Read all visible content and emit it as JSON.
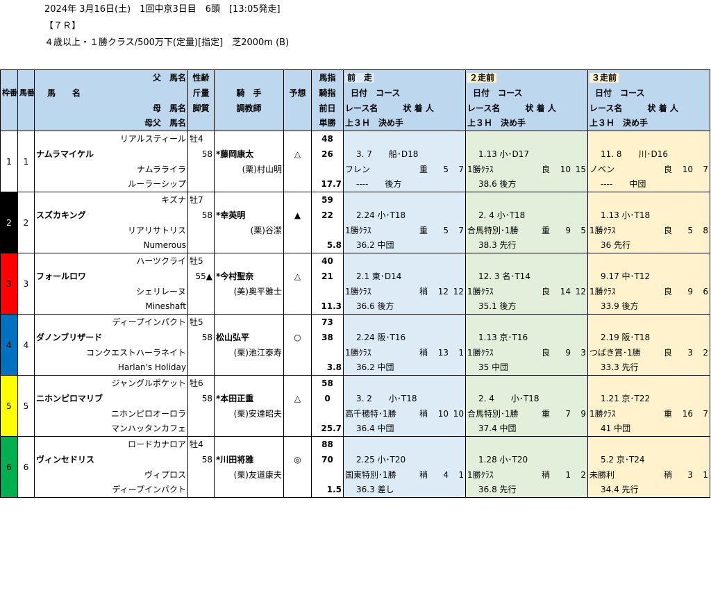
{
  "header": {
    "line1": "2024年 3月16日(土)　1回中京3日目　6頭　[13:05発走]",
    "line2": "【７Ｒ】",
    "line3": "４歳以上・１勝クラス/500万下(定量)[指定]　芝2000m (B)"
  },
  "columns": {
    "waku": "枠番",
    "umaban": "馬番",
    "father": "父　馬名",
    "horse_name": "馬　　名",
    "mother": "母　馬名",
    "mothers_father": "母父　馬名",
    "sex_age": "性齢",
    "weight": "斤量",
    "style": "脚質",
    "jockey": "騎　手",
    "trainer": "調教師",
    "prediction": "予想",
    "index1": "馬指",
    "index2": "騎指",
    "index3": "前日",
    "index4": "単勝",
    "prev1": "前　走",
    "prev2": "２走前",
    "prev3": "３走前",
    "date_course": "日付　コース",
    "race_result": "レース名　　　状 着 人",
    "last3f": "上３Ｈ　決め手"
  },
  "colors": {
    "header_bg": "#bdd7ee",
    "prev1_bg": "#ddebf7",
    "prev2_bg": "#e2efda",
    "prev3_bg": "#fff2cc"
  },
  "horses": [
    {
      "waku": "1",
      "umaban": "1",
      "frame_color": "#ffffff",
      "frame_text": "#000000",
      "father": "リアルスティール",
      "name": "ナムラマイケル",
      "mother": "ナムラライラ",
      "mothers_father": "ルーラーシップ",
      "sex_age": "牡4",
      "weight": "58",
      "jockey": "*藤岡康太",
      "trainer": "(栗)村山明",
      "mark": "△",
      "index1": "48",
      "index2": "26",
      "odds": "17.7",
      "prev": [
        {
          "date_course": "3. 7　　船･D18",
          "race": "フレン",
          "cond": "重",
          "pos": "5",
          "pop": "7",
          "last3f": "----　　後方"
        },
        {
          "date_course": "1.13 小･D17",
          "race": "1勝ｸﾗｽ",
          "cond": "良",
          "pos": "10",
          "pop": "15",
          "last3f": "38.6 後方"
        },
        {
          "date_course": "11. 8　　川･D16",
          "race": "ノベン",
          "cond": "良",
          "pos": "10",
          "pop": "7",
          "last3f": "----　　中団"
        }
      ]
    },
    {
      "waku": "2",
      "umaban": "2",
      "frame_color": "#000000",
      "frame_text": "#ffffff",
      "father": "キズナ",
      "name": "スズカキング",
      "mother": "リアリサトリス",
      "mothers_father": "Numerous",
      "sex_age": "牡7",
      "weight": "58",
      "jockey": "*幸英明",
      "trainer": "(栗)谷潔",
      "mark": "▲",
      "index1": "59",
      "index2": "22",
      "odds": "5.8",
      "prev": [
        {
          "date_course": "2.24 小･T18",
          "race": "1勝ｸﾗｽ",
          "cond": "重",
          "pos": "5",
          "pop": "7",
          "last3f": "36.2 中団"
        },
        {
          "date_course": "2. 4 小･T18",
          "race": "合馬特別･1勝",
          "cond": "重",
          "pos": "9",
          "pop": "5",
          "last3f": "38.3 先行"
        },
        {
          "date_course": "1.13 小･T18",
          "race": "1勝ｸﾗｽ",
          "cond": "良",
          "pos": "5",
          "pop": "8",
          "last3f": "36 先行"
        }
      ]
    },
    {
      "waku": "3",
      "umaban": "3",
      "frame_color": "#ff0000",
      "frame_text": "#000000",
      "father": "ハーツクライ",
      "name": "フォールロワ",
      "mother": "シェリレーヌ",
      "mothers_father": "Mineshaft",
      "sex_age": "牡5",
      "weight": "55▲",
      "jockey": "*今村聖奈",
      "trainer": "(美)奥平雅士",
      "mark": "△",
      "index1": "40",
      "index2": "21",
      "odds": "11.3",
      "prev": [
        {
          "date_course": "2.1 東･D14",
          "race": "1勝ｸﾗｽ",
          "cond": "稍",
          "pos": "12",
          "pop": "12",
          "last3f": "36.6 後方"
        },
        {
          "date_course": "12. 3 名･T14",
          "race": "1勝ｸﾗｽ",
          "cond": "良",
          "pos": "14",
          "pop": "12",
          "last3f": "35.1 後方"
        },
        {
          "date_course": "9.17 中･T12",
          "race": "1勝ｸﾗｽ",
          "cond": "良",
          "pos": "9",
          "pop": "6",
          "last3f": "33.9 後方"
        }
      ]
    },
    {
      "waku": "4",
      "umaban": "4",
      "frame_color": "#0070c0",
      "frame_text": "#000000",
      "father": "ディープインパクト",
      "name": "ダノンブリザード",
      "mother": "コンクエストハーラネイト",
      "mothers_father": "Harlan's Holiday",
      "sex_age": "牡5",
      "weight": "58",
      "jockey": "松山弘平",
      "trainer": "(栗)池江泰寿",
      "mark": "○",
      "index1": "73",
      "index2": "38",
      "odds": "3.8",
      "prev": [
        {
          "date_course": "2.24 阪･T16",
          "race": "1勝ｸﾗｽ",
          "cond": "稍",
          "pos": "13",
          "pop": "1",
          "last3f": "36.2 中団"
        },
        {
          "date_course": "1.13 京･T16",
          "race": "1勝ｸﾗｽ",
          "cond": "良",
          "pos": "9",
          "pop": "3",
          "last3f": "35 中団"
        },
        {
          "date_course": "2.19 阪･T18",
          "race": "つばき賞･1勝",
          "cond": "良",
          "pos": "3",
          "pop": "2",
          "last3f": "33.3 先行"
        }
      ]
    },
    {
      "waku": "5",
      "umaban": "5",
      "frame_color": "#ffff00",
      "frame_text": "#000000",
      "father": "ジャングルポケット",
      "name": "ニホンピロマリブ",
      "mother": "ニホンピロオーロラ",
      "mothers_father": "マンハッタンカフェ",
      "sex_age": "牡6",
      "weight": "58",
      "jockey": "*本田正重",
      "trainer": "(栗)安達昭夫",
      "mark": "△",
      "index1": "58",
      "index2": "0",
      "odds": "25.7",
      "prev": [
        {
          "date_course": "3. 2　　小･T18",
          "race": "高千穂特･1勝",
          "cond": "稍",
          "pos": "10",
          "pop": "10",
          "last3f": "36.4 中団"
        },
        {
          "date_course": "2. 4　　小･T18",
          "race": "合馬特別･1勝",
          "cond": "重",
          "pos": "7",
          "pop": "9",
          "last3f": "37.4 中団"
        },
        {
          "date_course": "1.21 京･T22",
          "race": "1勝ｸﾗｽ",
          "cond": "重",
          "pos": "16",
          "pop": "7",
          "last3f": "41 中団"
        }
      ]
    },
    {
      "waku": "6",
      "umaban": "6",
      "frame_color": "#00b050",
      "frame_text": "#000000",
      "father": "ロードカナロア",
      "name": "ヴィンセドリス",
      "mother": "ヴィプロス",
      "mothers_father": "ディープインパクト",
      "sex_age": "牡4",
      "weight": "58",
      "jockey": "*川田将雅",
      "trainer": "(栗)友道康夫",
      "mark": "◎",
      "index1": "88",
      "index2": "70",
      "odds": "1.5",
      "prev": [
        {
          "date_course": "2.25 小･T20",
          "race": "国東特別･1勝",
          "cond": "稍",
          "pos": "4",
          "pop": "1",
          "last3f": "36.3 差し"
        },
        {
          "date_course": "1.28 小･T20",
          "race": "1勝ｸﾗｽ",
          "cond": "稍",
          "pos": "1",
          "pop": "2",
          "last3f": "36.8 先行"
        },
        {
          "date_course": "5.2 京･T24",
          "race": "未勝利",
          "cond": "稍",
          "pos": "3",
          "pop": "1",
          "last3f": "34.4 先行"
        }
      ]
    }
  ]
}
